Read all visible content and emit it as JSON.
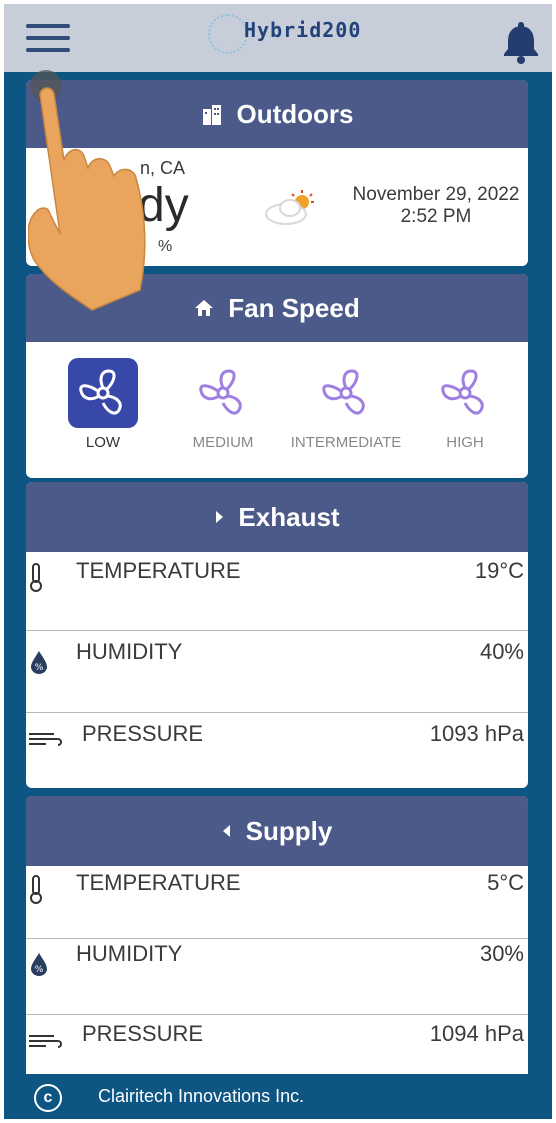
{
  "header": {
    "brand": "Hybrid200"
  },
  "outdoors": {
    "title": "Outdoors",
    "location_partial": "n, CA",
    "condition_partial": "dy",
    "humidity_partial": "%",
    "date": "November 29, 2022",
    "time": "2:52 PM"
  },
  "fan_speed": {
    "title": "Fan Speed",
    "options": [
      "LOW",
      "MEDIUM",
      "INTERMEDIATE",
      "HIGH"
    ],
    "selected": "LOW"
  },
  "exhaust": {
    "title": "Exhaust",
    "rows": [
      {
        "label": "TEMPERATURE",
        "value": "19°C"
      },
      {
        "label": "HUMIDITY",
        "value": "40%"
      },
      {
        "label": "PRESSURE",
        "value": "1093 hPa"
      }
    ]
  },
  "supply": {
    "title": "Supply",
    "rows": [
      {
        "label": "TEMPERATURE",
        "value": "5°C"
      },
      {
        "label": "HUMIDITY",
        "value": "30%"
      },
      {
        "label": "PRESSURE",
        "value": "1094 hPa"
      }
    ]
  },
  "footer": {
    "copyright_symbol": "c",
    "company": "Clairitech Innovations Inc."
  },
  "icons": {
    "menu": "hamburger-menu-icon",
    "bell": "bell-icon",
    "building": "building-icon",
    "home": "home-icon",
    "weather": "partly-sunny-icon",
    "fan": "fan-icon",
    "thermometer": "thermometer-icon",
    "humidity": "humidity-drop-icon",
    "wind": "wind-icon"
  },
  "colors": {
    "primary": "#0d5582",
    "header": "#4c5a8a",
    "accent": "#3848a8",
    "fan_inactive": "#9f7fe0"
  }
}
